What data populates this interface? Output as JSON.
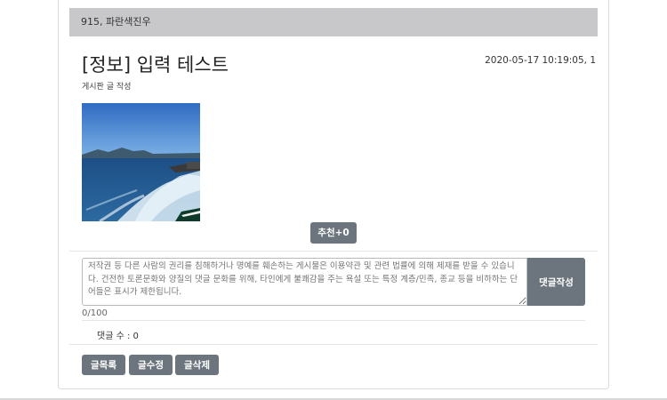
{
  "post": {
    "author_line": "915, 파란색진우",
    "title": "[정보] 입력 테스트",
    "datetime": "2020-05-17 10:19:05, 1",
    "subtitle": "게시판 글 작성",
    "photo_icon": "ocean-wake-photo"
  },
  "actions": {
    "recommend_label": "추천+0"
  },
  "comment_form": {
    "placeholder": "저작권 등 다른 사람의 권리를 침해하거나 명예를 훼손하는 게시물은 이용약관 및 관련 법률에 의해 제재를 받을 수 있습니다. 건전한 토론문화와 양질의 댓글 문화를 위해, 타인에게 불쾌감을 주는 욕설 또는 특정 계층/민족, 종교 등을 비하하는 단어들은 표시가 제한됩니다.",
    "value": "",
    "submit_label": "댓글작성",
    "char_counter": "0/100"
  },
  "comments": {
    "count_text": "댓글 수 : 0"
  },
  "footer_buttons": {
    "list_label": "글목록",
    "edit_label": "글수정",
    "delete_label": "글삭제"
  },
  "colors": {
    "button": "#6c757d",
    "author_bar": "#c8c8ca"
  }
}
